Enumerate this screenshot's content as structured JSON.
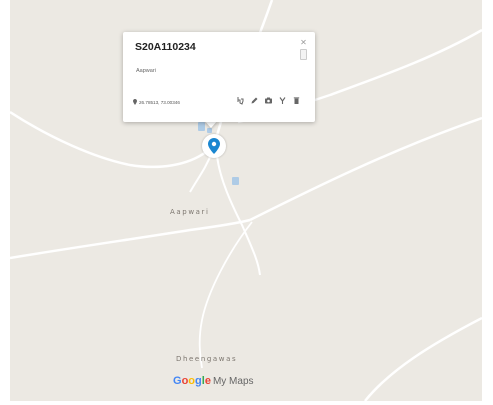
{
  "map": {
    "background_color": "#ece9e3",
    "road_color": "#ffffff",
    "water_color": "#aecbe6",
    "place_labels": [
      "Aapwari",
      "Dheengawas"
    ]
  },
  "marker": {
    "color": "#1a86d0",
    "icon": "map-pin-icon"
  },
  "popup": {
    "title": "S20A110234",
    "subtitle": "Aapwari",
    "coordinates": "26.78513, 73.00346",
    "close_icon": "close-icon",
    "actions": [
      {
        "icon": "pan-icon"
      },
      {
        "icon": "edit-pencil-icon"
      },
      {
        "icon": "camera-icon"
      },
      {
        "icon": "style-icon"
      },
      {
        "icon": "delete-icon"
      }
    ]
  },
  "branding": {
    "google_letters": [
      "G",
      "o",
      "o",
      "g",
      "l",
      "e"
    ],
    "product": "My Maps"
  }
}
